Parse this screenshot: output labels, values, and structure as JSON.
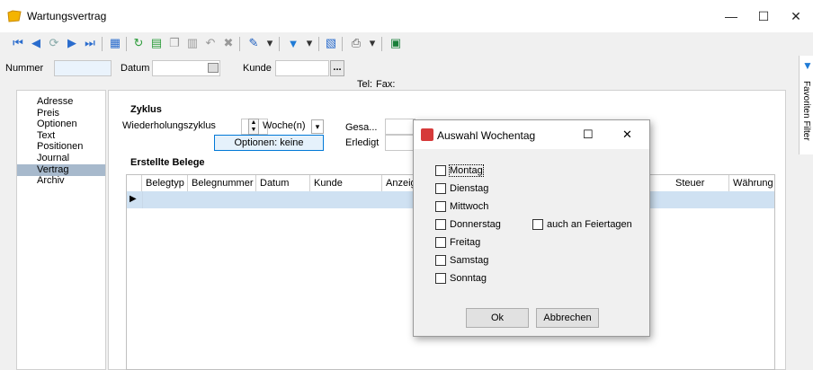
{
  "window": {
    "title": "Wartungsvertrag",
    "minimize": "—",
    "maximize": "☐",
    "close": "✕"
  },
  "header": {
    "nummer_label": "Nummer",
    "nummer_value": "",
    "datum_label": "Datum",
    "datum_value": "",
    "kunde_label": "Kunde",
    "kunde_value": "",
    "kunde_btn": "...",
    "tel_label": "Tel:",
    "fax_label": "Fax:"
  },
  "nav": {
    "items": [
      "Adresse",
      "Preis",
      "Optionen",
      "Text",
      "Positionen",
      "Journal",
      "Vertrag",
      "Archiv"
    ],
    "selected": "Vertrag"
  },
  "zyklus": {
    "title": "Zyklus",
    "label": "Wiederholungszyklus",
    "count": "",
    "unit": "Woche(n)",
    "options_btn": "Optionen: keine",
    "gesamt_label": "Gesa...",
    "erledigt_label": "Erledigt"
  },
  "belege": {
    "title": "Erstellte Belege",
    "columns": [
      "Belegtyp",
      "Belegnummer",
      "Datum",
      "Kunde",
      "Anzeig",
      "Steuer",
      "Währung"
    ]
  },
  "side_tab": {
    "label": "Favoriten Filter"
  },
  "dialog": {
    "title": "Auswahl Wochentag",
    "days": [
      "Montag",
      "Dienstag",
      "Mittwoch",
      "Donnerstag",
      "Freitag",
      "Samstag",
      "Sonntag"
    ],
    "feiertage": "auch an Feiertagen",
    "ok": "Ok",
    "cancel": "Abbrechen",
    "maximize": "☐",
    "close": "✕"
  },
  "colors": {
    "accent": "#0078d7",
    "selected_nav": "#a7b9cc",
    "grid_row": "#cfe1f2"
  }
}
